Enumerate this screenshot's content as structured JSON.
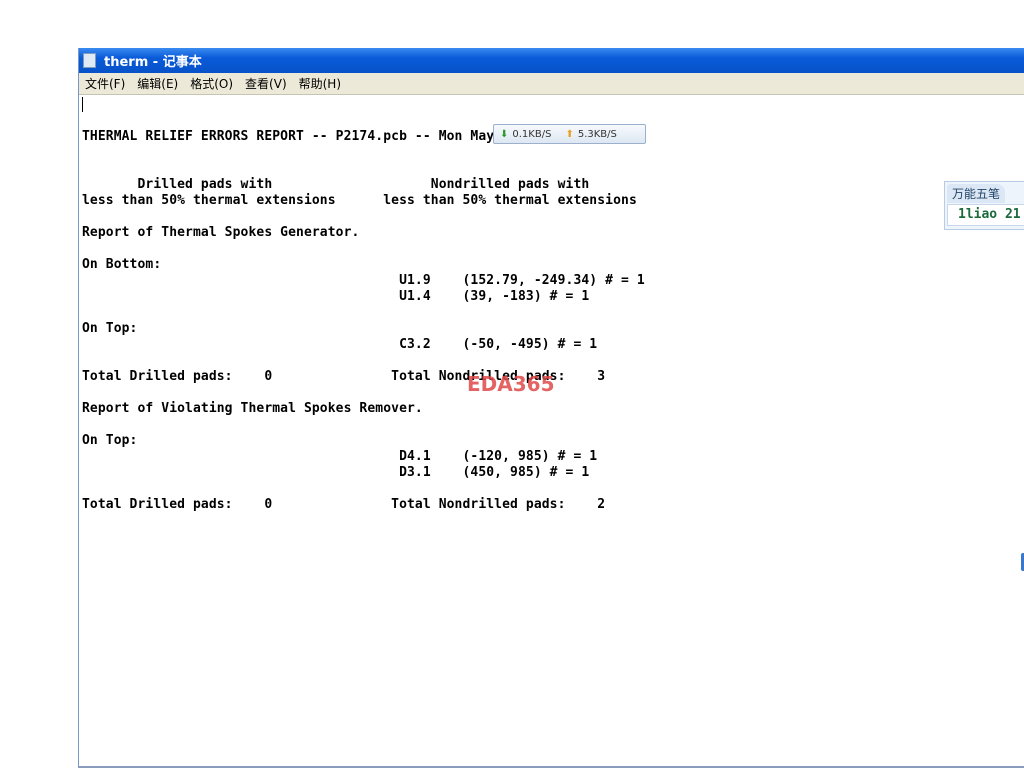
{
  "window": {
    "title": "therm - 记事本"
  },
  "menu": [
    "文件(F)",
    "编辑(E)",
    "格式(O)",
    "查看(V)",
    "帮助(H)"
  ],
  "lines": [
    "",
    "",
    "THERMAL RELIEF ERRORS REPORT -- P2174.pcb -- Mon May",
    "",
    "",
    "       Drilled pads with                    Nondrilled pads with",
    "less than 50% thermal extensions      less than 50% thermal extensions",
    "",
    "Report of Thermal Spokes Generator.",
    "",
    "On Bottom:",
    "                                        U1.9    (152.79, -249.34) # = 1",
    "                                        U1.4    (39, -183) # = 1",
    "",
    "On Top:",
    "                                        C3.2    (-50, -495) # = 1",
    "",
    "Total Drilled pads:    0               Total Nondrilled pads:    3",
    "",
    "Report of Violating Thermal Spokes Remover.",
    "",
    "On Top:",
    "                                        D4.1    (-120, 985) # = 1",
    "                                        D3.1    (450, 985) # = 1",
    "",
    "Total Drilled pads:    0               Total Nondrilled pads:    2"
  ],
  "net_monitor": {
    "download": "0.1KB/S",
    "upload": "5.3KB/S"
  },
  "watermark": "EDA365",
  "ime": {
    "name": "万能五笔",
    "code": "1liao 21"
  }
}
